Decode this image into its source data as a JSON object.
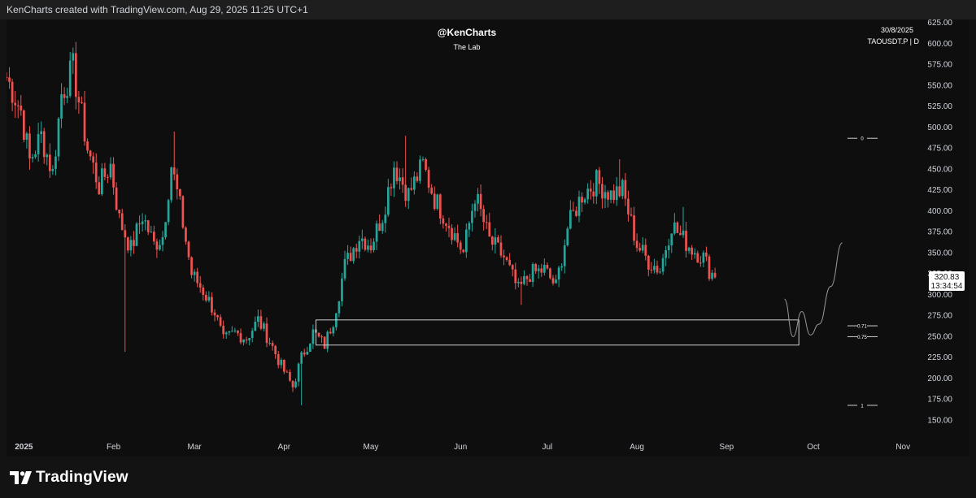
{
  "header": {
    "credit": "KenCharts created with TradingView.com, Aug 29, 2025 11:25 UTC+1"
  },
  "watermark": {
    "author": "@KenCharts",
    "subtitle": "The Lab"
  },
  "info": {
    "date": "30/8/2025",
    "symbol": "TAOUSDT.P | D"
  },
  "price_label": {
    "value": "320.83",
    "countdown": "13:34:54"
  },
  "fib_levels": [
    {
      "label": "0",
      "price": 487
    },
    {
      "label": "0.71",
      "price": 263
    },
    {
      "label": "0.75",
      "price": 250
    },
    {
      "label": "1",
      "price": 168
    }
  ],
  "brand": {
    "name": "TradingView"
  },
  "colors": {
    "up": "#26a69a",
    "down": "#ef5350",
    "background": "#0e0e0e",
    "text": "#d1d4dc"
  },
  "chart_data": {
    "type": "candlestick",
    "symbol": "TAOUSDT.P",
    "timeframe": "D",
    "x_axis": {
      "range": [
        "2024-12-26",
        "2025-11-06"
      ],
      "ticks": [
        {
          "label": "2025",
          "date": "2025-01-01"
        },
        {
          "label": "Feb",
          "date": "2025-02-01"
        },
        {
          "label": "Mar",
          "date": "2025-03-01"
        },
        {
          "label": "Apr",
          "date": "2025-04-01"
        },
        {
          "label": "May",
          "date": "2025-05-01"
        },
        {
          "label": "Jun",
          "date": "2025-06-01"
        },
        {
          "label": "Jul",
          "date": "2025-07-01"
        },
        {
          "label": "Aug",
          "date": "2025-08-01"
        },
        {
          "label": "Sep",
          "date": "2025-09-01"
        },
        {
          "label": "Oct",
          "date": "2025-10-01"
        },
        {
          "label": "Nov",
          "date": "2025-11-01"
        }
      ]
    },
    "y_axis": {
      "range": [
        150,
        625
      ],
      "ticks": [
        "625.00",
        "600.00",
        "575.00",
        "550.00",
        "525.00",
        "500.00",
        "475.00",
        "450.00",
        "425.00",
        "400.00",
        "375.00",
        "350.00",
        "325.00",
        "300.00",
        "275.00",
        "250.00",
        "225.00",
        "200.00",
        "175.00",
        "150.00"
      ]
    },
    "price_path": [
      [
        "2024-12-26",
        560
      ],
      [
        "2024-12-31",
        520
      ],
      [
        "2025-01-03",
        460
      ],
      [
        "2025-01-07",
        490
      ],
      [
        "2025-01-11",
        445
      ],
      [
        "2025-01-14",
        540
      ],
      [
        "2025-01-18",
        570
      ],
      [
        "2025-01-23",
        475
      ],
      [
        "2025-01-27",
        430
      ],
      [
        "2025-01-31",
        455
      ],
      [
        "2025-02-03",
        390
      ],
      [
        "2025-02-07",
        355
      ],
      [
        "2025-02-11",
        395
      ],
      [
        "2025-02-15",
        360
      ],
      [
        "2025-02-18",
        370
      ],
      [
        "2025-02-21",
        455
      ],
      [
        "2025-02-24",
        405
      ],
      [
        "2025-02-28",
        325
      ],
      [
        "2025-03-04",
        305
      ],
      [
        "2025-03-08",
        280
      ],
      [
        "2025-03-11",
        245
      ],
      [
        "2025-03-15",
        255
      ],
      [
        "2025-03-19",
        248
      ],
      [
        "2025-03-23",
        270
      ],
      [
        "2025-03-27",
        245
      ],
      [
        "2025-03-31",
        215
      ],
      [
        "2025-04-04",
        190
      ],
      [
        "2025-04-07",
        225
      ],
      [
        "2025-04-11",
        255
      ],
      [
        "2025-04-15",
        240
      ],
      [
        "2025-04-18",
        270
      ],
      [
        "2025-04-22",
        335
      ],
      [
        "2025-04-27",
        370
      ],
      [
        "2025-05-01",
        360
      ],
      [
        "2025-05-05",
        395
      ],
      [
        "2025-05-09",
        455
      ],
      [
        "2025-05-14",
        420
      ],
      [
        "2025-05-19",
        455
      ],
      [
        "2025-05-23",
        415
      ],
      [
        "2025-05-28",
        385
      ],
      [
        "2025-06-02",
        350
      ],
      [
        "2025-06-06",
        420
      ],
      [
        "2025-06-11",
        365
      ],
      [
        "2025-06-16",
        345
      ],
      [
        "2025-06-21",
        305
      ],
      [
        "2025-06-25",
        325
      ],
      [
        "2025-06-30",
        330
      ],
      [
        "2025-07-04",
        310
      ],
      [
        "2025-07-08",
        380
      ],
      [
        "2025-07-13",
        420
      ],
      [
        "2025-07-18",
        435
      ],
      [
        "2025-07-23",
        420
      ],
      [
        "2025-07-27",
        425
      ],
      [
        "2025-08-01",
        360
      ],
      [
        "2025-08-05",
        340
      ],
      [
        "2025-08-09",
        330
      ],
      [
        "2025-08-13",
        385
      ],
      [
        "2025-08-16",
        370
      ],
      [
        "2025-08-20",
        355
      ],
      [
        "2025-08-24",
        345
      ],
      [
        "2025-08-26",
        330
      ],
      [
        "2025-08-28",
        321
      ]
    ],
    "wick_highs": [
      [
        "2025-01-17",
        590
      ],
      [
        "2025-02-22",
        495
      ],
      [
        "2025-05-13",
        490
      ],
      [
        "2025-07-26",
        462
      ],
      [
        "2025-08-17",
        405
      ]
    ],
    "wick_lows": [
      [
        "2025-02-05",
        232
      ],
      [
        "2025-04-07",
        168
      ],
      [
        "2025-06-22",
        288
      ]
    ],
    "last_price": 320.83,
    "zone": {
      "from": "2025-04-12",
      "to": "2025-09-26",
      "price_low": 240,
      "price_high": 270
    },
    "projection": [
      [
        "2025-09-21",
        295
      ],
      [
        "2025-09-24",
        250
      ],
      [
        "2025-09-27",
        280
      ],
      [
        "2025-09-30",
        252
      ],
      [
        "2025-10-03",
        265
      ],
      [
        "2025-10-07",
        310
      ],
      [
        "2025-10-11",
        362
      ]
    ]
  }
}
